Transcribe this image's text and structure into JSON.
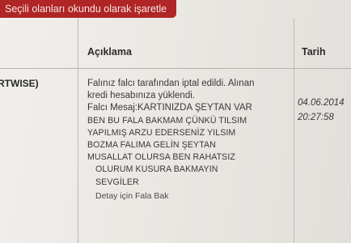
{
  "mark_read_button": "Seçili olanları okundu olarak işaretle",
  "table": {
    "headers": {
      "description": "Açıklama",
      "date": "Tarih"
    },
    "row": {
      "user": "RTWISE)",
      "description_lines": [
        "Falınız falcı tarafından iptal edildi. Alınan",
        "kredi hesabınıza yüklendi."
      ],
      "message_lines": [
        "Falcı Mesaj:KARTINIZDA ŞEYTAN VAR",
        "BEN BU FALA BAKMAM ÇÜNKÜ TILSIM",
        "YAPILMIŞ ARZU EDERSENİZ YILSIM",
        "BOZMA FALIMA GELİN ŞEYTAN",
        "MUSALLAT OLURSA BEN RAHATSIZ",
        "OLURUM KUSURA BAKMAYIN",
        "SEVGİLER"
      ],
      "detail_link": "Detay için Fala Bak",
      "date": "04.06.2014",
      "time": "20:27:58"
    }
  }
}
